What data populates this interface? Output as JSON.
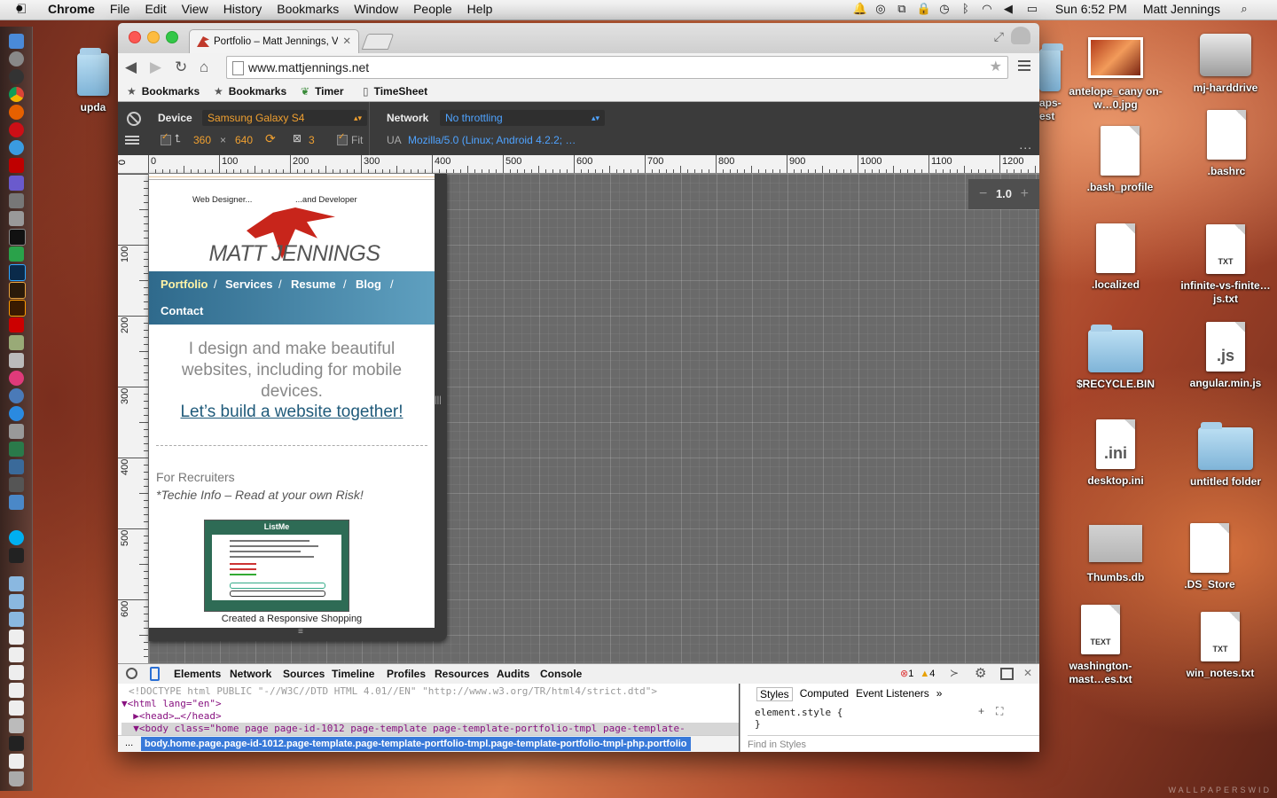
{
  "menubar": {
    "apple": "",
    "app": "Chrome",
    "menus": [
      "File",
      "Edit",
      "View",
      "History",
      "Bookmarks",
      "Window",
      "People",
      "Help"
    ],
    "clock": "Sun 6:52 PM",
    "user": "Matt Jennings"
  },
  "desktop": {
    "icons": [
      {
        "label": "antelope_cany on-w…0.jpg"
      },
      {
        "label": "mj-harddrive"
      },
      {
        "label": ".bash_profile"
      },
      {
        "label": ".bashrc"
      },
      {
        "label": ".localized"
      },
      {
        "label": "infinite-vs-finite…js.txt",
        "tag": "TXT"
      },
      {
        "label": "$RECYCLE.BIN"
      },
      {
        "label": "angular.min.js",
        "tag": ".js"
      },
      {
        "label": "desktop.ini",
        "tag": ".ini"
      },
      {
        "label": "untitled folder"
      },
      {
        "label": "Thumbs.db"
      },
      {
        "label": ".DS_Store"
      },
      {
        "label": "washington-mast…es.txt",
        "tag": "TEXT"
      },
      {
        "label": "win_notes.txt",
        "tag": "TXT"
      }
    ],
    "partial": [
      "upda",
      "aps-",
      "est"
    ],
    "watermark": "WALLPAPERSWID"
  },
  "browser": {
    "tab_title": "Portfolio – Matt Jennings, V",
    "tab_close": "✕",
    "url": "www.mattjennings.net",
    "bookmarks": [
      "Bookmarks",
      "Bookmarks",
      "Timer",
      "TimeSheet"
    ]
  },
  "emulation": {
    "device_label": "Device",
    "device_value": "Samsung Galaxy S4",
    "width": "360",
    "times": "×",
    "height": "640",
    "dpr": "3",
    "fit": "Fit",
    "network_label": "Network",
    "network_value": "No throttling",
    "ua_label": "UA",
    "ua_value": "Mozilla/5.0 (Linux; Android 4.2.2; …",
    "zoom": "1.0",
    "more": "..."
  },
  "rulers": {
    "h": [
      "0",
      "100",
      "200",
      "300",
      "400",
      "500",
      "600",
      "700",
      "800",
      "900",
      "1000",
      "1100",
      "1200"
    ],
    "v": [
      "0",
      "100",
      "200",
      "300",
      "400",
      "500",
      "600"
    ]
  },
  "site": {
    "tag_left": "Web Designer...",
    "tag_right": "...and Developer",
    "logo_name": "MATT JENNINGS",
    "nav": [
      "Portfolio",
      "Services",
      "Resume",
      "Blog",
      "Contact"
    ],
    "sep": "/",
    "hero": "I design and make beautiful websites, including for mobile devices.",
    "cta": "Let’s build a website together!",
    "recruiters": "For Recruiters",
    "techie": "*Techie Info – Read at your own Risk!",
    "thumb_title": "ListMe",
    "caption": "Created a Responsive Shopping"
  },
  "devtools": {
    "tabs": [
      "Elements",
      "Network",
      "Sources",
      "Timeline",
      "Profiles",
      "Resources",
      "Audits",
      "Console"
    ],
    "errors": "1",
    "warnings": "4",
    "lines": [
      "<!DOCTYPE html PUBLIC \"-//W3C//DTD HTML 4.01//EN\" \"http://www.w3.org/TR/html4/strict.dtd\">",
      "▼<html lang=\"en\">",
      "  ▶<head>…</head>",
      "  ▼<body class=\"home page page-id-1012 page-template page-template-portfolio-tmpl page-template-"
    ],
    "crumb_prefix": "...",
    "crumb": "body.home.page.page-id-1012.page-template.page-template-portfolio-tmpl.page-template-portfolio-tmpl-php.portfolio",
    "style_tabs": [
      "Styles",
      "Computed",
      "Event Listeners"
    ],
    "style_more": "»",
    "element_style": "element.style {",
    "element_close": "}",
    "find": "Find in Styles"
  }
}
